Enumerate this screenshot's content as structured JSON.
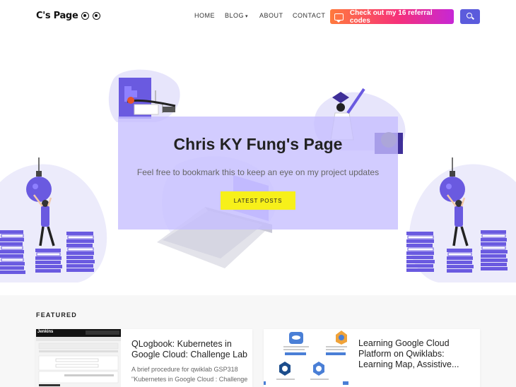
{
  "header": {
    "logo_text": "C's Page",
    "nav": [
      {
        "label": "HOME"
      },
      {
        "label": "BLOG",
        "caret": "▾"
      },
      {
        "label": "ABOUT"
      },
      {
        "label": "CONTACT"
      }
    ],
    "referral_label": "Check out my 16 referral codes",
    "colors": {
      "search_button": "#5b5bdc",
      "referral_gradient_start": "#ff7a3d",
      "referral_gradient_end": "#c627d6"
    }
  },
  "hero": {
    "title": "Chris KY Fung's Page",
    "subtitle": "Feel free to bookmark this to keep an eye on my project updates",
    "button_label": "LATEST POSTS",
    "colors": {
      "accent": "#5b4fd9",
      "card_overlay": "#c5beff",
      "button": "#f7f01a"
    }
  },
  "featured": {
    "heading": "FEATURED",
    "posts": [
      {
        "title": "QLogbook: Kubernetes in Google Cloud: Challenge Lab",
        "excerpt_lines": [
          "A brief procedure for qwiklab GSP318",
          "\"Kubernetes in Google Cloud : Challenge"
        ],
        "thumb_header": "Jenkins"
      },
      {
        "title": "Learning Google Cloud Platform on Qwiklabs: Learning Map, Assistive...",
        "excerpt_lines": []
      }
    ]
  }
}
